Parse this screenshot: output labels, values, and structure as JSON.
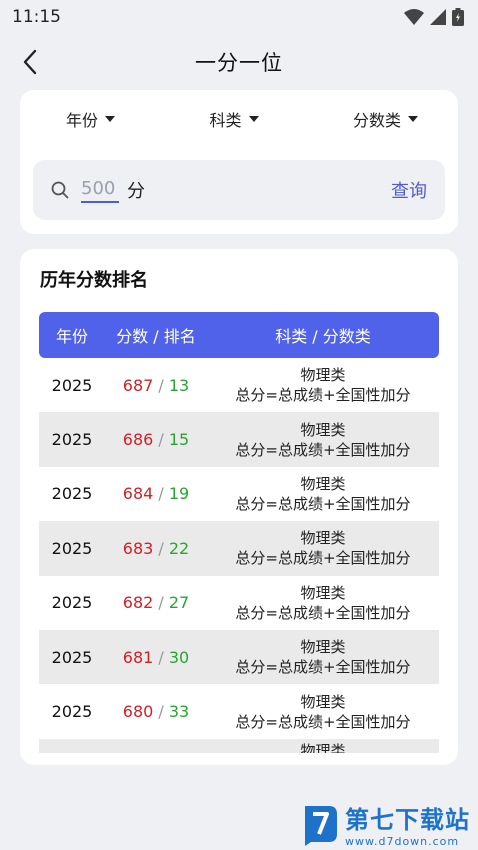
{
  "status": {
    "time": "11:15"
  },
  "header": {
    "title": "一分一位"
  },
  "filters": [
    {
      "label": "年份"
    },
    {
      "label": "科类"
    },
    {
      "label": "分数类"
    }
  ],
  "search": {
    "value": "",
    "placeholder": "500",
    "unit": "分",
    "button": "查询"
  },
  "ranking": {
    "title": "历年分数排名",
    "columns": {
      "year": "年份",
      "score": "分数",
      "sep": " / ",
      "rank": "排名",
      "type": "科类 / 分数类"
    },
    "rows": [
      {
        "year": "2025",
        "score": "687",
        "rank": "13",
        "category": "物理类",
        "formula": "总分=总成绩+全国性加分"
      },
      {
        "year": "2025",
        "score": "686",
        "rank": "15",
        "category": "物理类",
        "formula": "总分=总成绩+全国性加分"
      },
      {
        "year": "2025",
        "score": "684",
        "rank": "19",
        "category": "物理类",
        "formula": "总分=总成绩+全国性加分"
      },
      {
        "year": "2025",
        "score": "683",
        "rank": "22",
        "category": "物理类",
        "formula": "总分=总成绩+全国性加分"
      },
      {
        "year": "2025",
        "score": "682",
        "rank": "27",
        "category": "物理类",
        "formula": "总分=总成绩+全国性加分"
      },
      {
        "year": "2025",
        "score": "681",
        "rank": "30",
        "category": "物理类",
        "formula": "总分=总成绩+全国性加分"
      },
      {
        "year": "2025",
        "score": "680",
        "rank": "33",
        "category": "物理类",
        "formula": "总分=总成绩+全国性加分"
      },
      {
        "year": "",
        "score": "",
        "rank": "",
        "category": "物理类",
        "formula": ""
      }
    ]
  },
  "watermark": {
    "name": "第七下载站",
    "url": "www.d7down.com"
  },
  "colors": {
    "accent": "#5062ea",
    "score": "#d32027",
    "rank": "#29a52f"
  }
}
